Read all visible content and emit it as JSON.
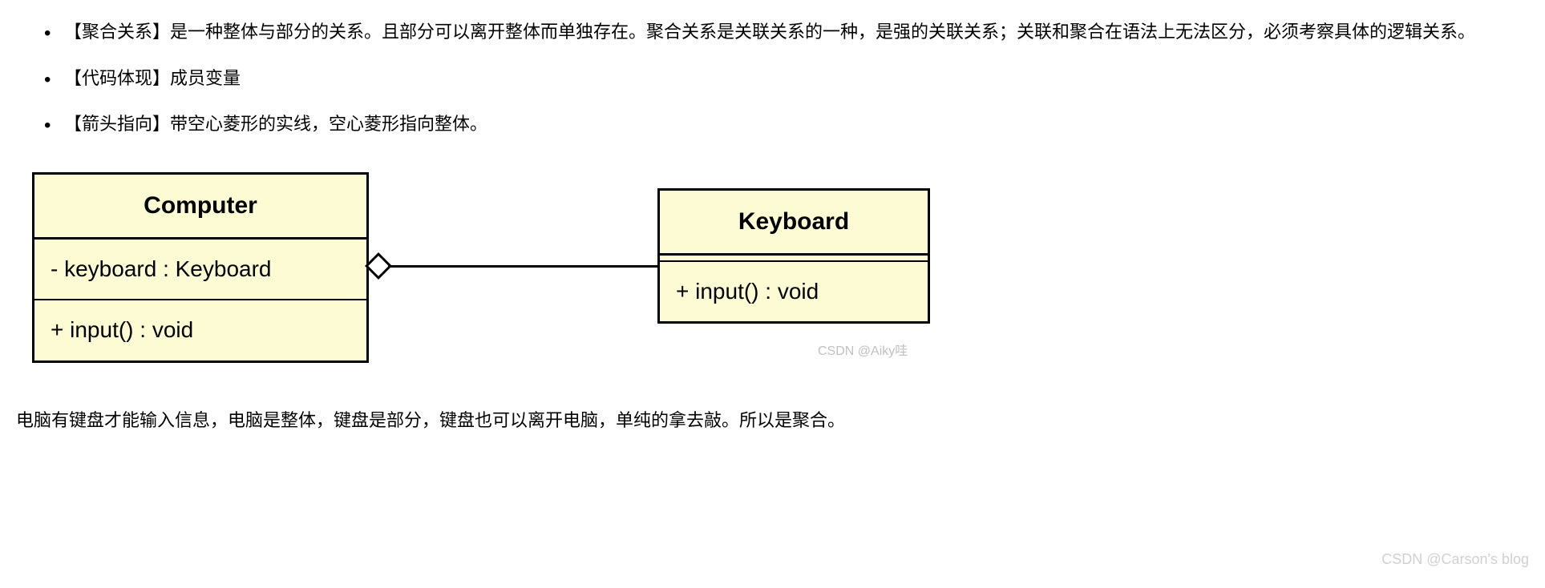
{
  "bullets": {
    "b1": "【聚合关系】是一种整体与部分的关系。且部分可以离开整体而单独存在。聚合关系是关联关系的一种，是强的关联关系；关联和聚合在语法上无法区分，必须考察具体的逻辑关系。",
    "b2": "【代码体现】成员变量",
    "b3": "【箭头指向】带空心菱形的实线，空心菱形指向整体。"
  },
  "uml": {
    "computer": {
      "name": "Computer",
      "attr": "- keyboard : Keyboard",
      "method": "+ input() : void"
    },
    "keyboard": {
      "name": "Keyboard",
      "method": "+ input() : void"
    }
  },
  "watermark_diagram": "CSDN @Aiky哇",
  "bottom_text": "电脑有键盘才能输入信息，电脑是整体，键盘是部分，键盘也可以离开电脑，单纯的拿去敲。所以是聚合。",
  "watermark_corner": "CSDN @Carson's blog"
}
